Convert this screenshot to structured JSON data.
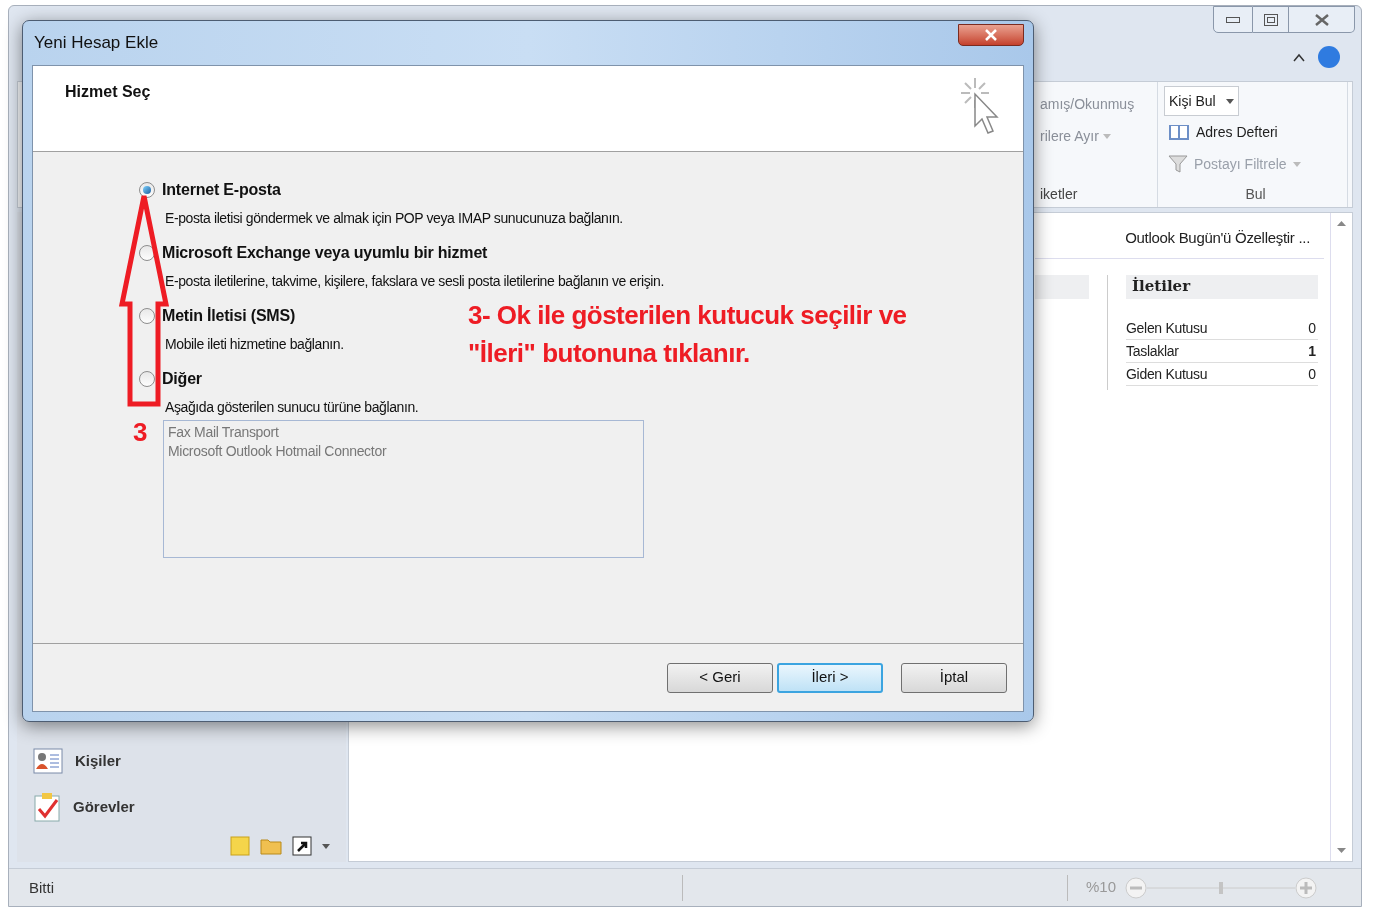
{
  "outlook_window": {
    "ribbon": {
      "cut_items": [
        {
          "label": "amış/Okunmuş",
          "disabled": true
        },
        {
          "label": "rilere Ayır",
          "disabled": true
        }
      ],
      "cut_group_label": "iketler",
      "find_group": {
        "items": [
          {
            "kind": "dropdown",
            "label": "Kişi Bul",
            "disabled": false
          },
          {
            "kind": "book",
            "label": "Adres Defteri",
            "disabled": false
          },
          {
            "kind": "filter",
            "label": "Postayı Filtrele",
            "disabled": true
          }
        ],
        "label": "Bul"
      }
    },
    "today_pane": {
      "customize_link": "Outlook Bugün'ü Özelleştir ...",
      "messages": {
        "title": "İletiler",
        "rows": [
          {
            "name": "Gelen Kutusu",
            "count": "0",
            "unread": false
          },
          {
            "name": "Taslaklar",
            "count": "1",
            "unread": true
          },
          {
            "name": "Giden Kutusu",
            "count": "0",
            "unread": false
          }
        ]
      }
    },
    "nav": [
      {
        "kind": "contacts",
        "label": "Kişiler"
      },
      {
        "kind": "tasks",
        "label": "Görevler"
      }
    ],
    "status_bar": {
      "text": "Bitti",
      "zoom": "%10",
      "zoom_slider": {
        "level": 0.5
      }
    }
  },
  "dialog": {
    "title": "Yeni Hesap Ekle",
    "header": "Hizmet Seç",
    "options": [
      {
        "label": "Internet E-posta",
        "description": "E-posta iletisi göndermek ve almak için POP veya IMAP sunucunuza bağlanın.",
        "selected": true
      },
      {
        "label": "Microsoft Exchange veya uyumlu bir hizmet",
        "description": "E-posta iletilerine, takvime, kişilere, fakslara ve sesli posta iletilerine bağlanın ve erişin.",
        "selected": false
      },
      {
        "label": "Metin İletisi (SMS)",
        "description": "Mobile ileti hizmetine bağlanın.",
        "selected": false
      },
      {
        "label": "Diğer",
        "description": "Aşağıda gösterilen sunucu türüne bağlanın.",
        "selected": false
      }
    ],
    "server_types": {
      "disabled": true,
      "items": [
        "Fax Mail Transport",
        "Microsoft Outlook Hotmail Connector"
      ]
    },
    "buttons": [
      {
        "label": "< Geri",
        "focused": false
      },
      {
        "label": "İleri >",
        "focused": true
      },
      {
        "label": "İptal",
        "focused": false
      }
    ]
  },
  "annotation": {
    "step": "3",
    "instruction": "3- Ok ile gösterilen kutucuk seçilir ve \"İleri\" butonuna tıklanır."
  }
}
